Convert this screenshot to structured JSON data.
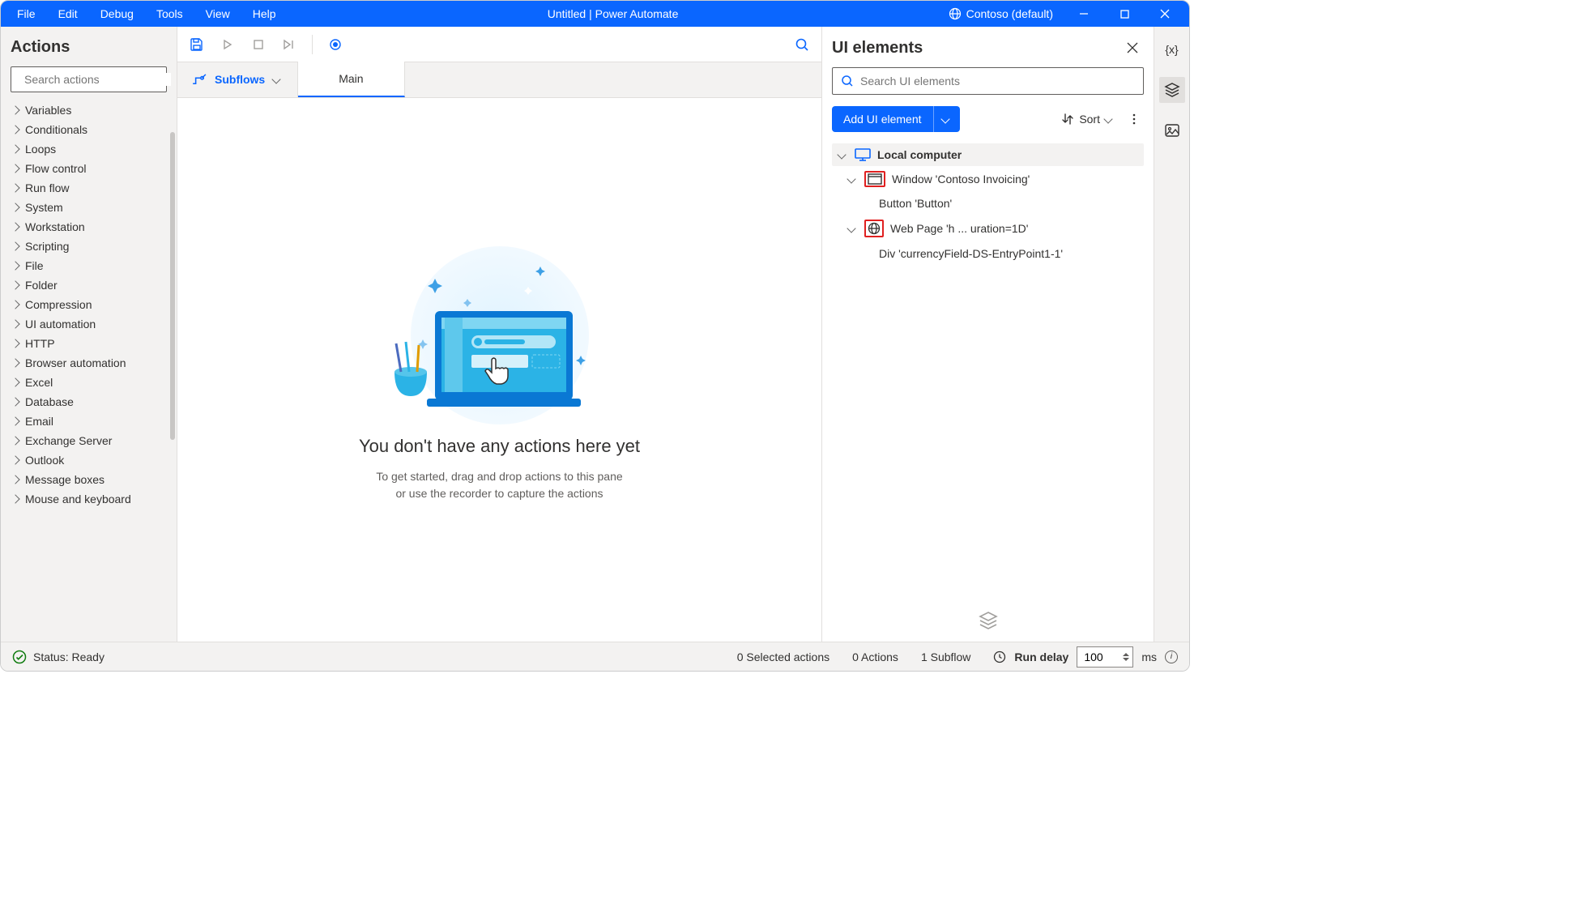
{
  "titlebar": {
    "menus": [
      "File",
      "Edit",
      "Debug",
      "Tools",
      "View",
      "Help"
    ],
    "title": "Untitled | Power Automate",
    "environment": "Contoso (default)"
  },
  "sidebar": {
    "title": "Actions",
    "search_placeholder": "Search actions",
    "categories": [
      "Variables",
      "Conditionals",
      "Loops",
      "Flow control",
      "Run flow",
      "System",
      "Workstation",
      "Scripting",
      "File",
      "Folder",
      "Compression",
      "UI automation",
      "HTTP",
      "Browser automation",
      "Excel",
      "Database",
      "Email",
      "Exchange Server",
      "Outlook",
      "Message boxes",
      "Mouse and keyboard"
    ]
  },
  "tabs": {
    "subflows_label": "Subflows",
    "main_tab": "Main"
  },
  "empty_state": {
    "title": "You don't have any actions here yet",
    "line1": "To get started, drag and drop actions to this pane",
    "line2": "or use the recorder to capture the actions"
  },
  "right_panel": {
    "title": "UI elements",
    "search_placeholder": "Search UI elements",
    "add_button": "Add UI element",
    "sort_label": "Sort",
    "tree_root": "Local computer",
    "window_item": "Window 'Contoso Invoicing'",
    "button_item": "Button 'Button'",
    "webpage_item": "Web Page 'h ... uration=1D'",
    "div_item": "Div 'currencyField-DS-EntryPoint1-1'"
  },
  "statusbar": {
    "status": "Status: Ready",
    "selected": "0 Selected actions",
    "actions": "0 Actions",
    "subflows": "1 Subflow",
    "run_delay_label": "Run delay",
    "run_delay_value": "100",
    "run_delay_unit": "ms"
  }
}
